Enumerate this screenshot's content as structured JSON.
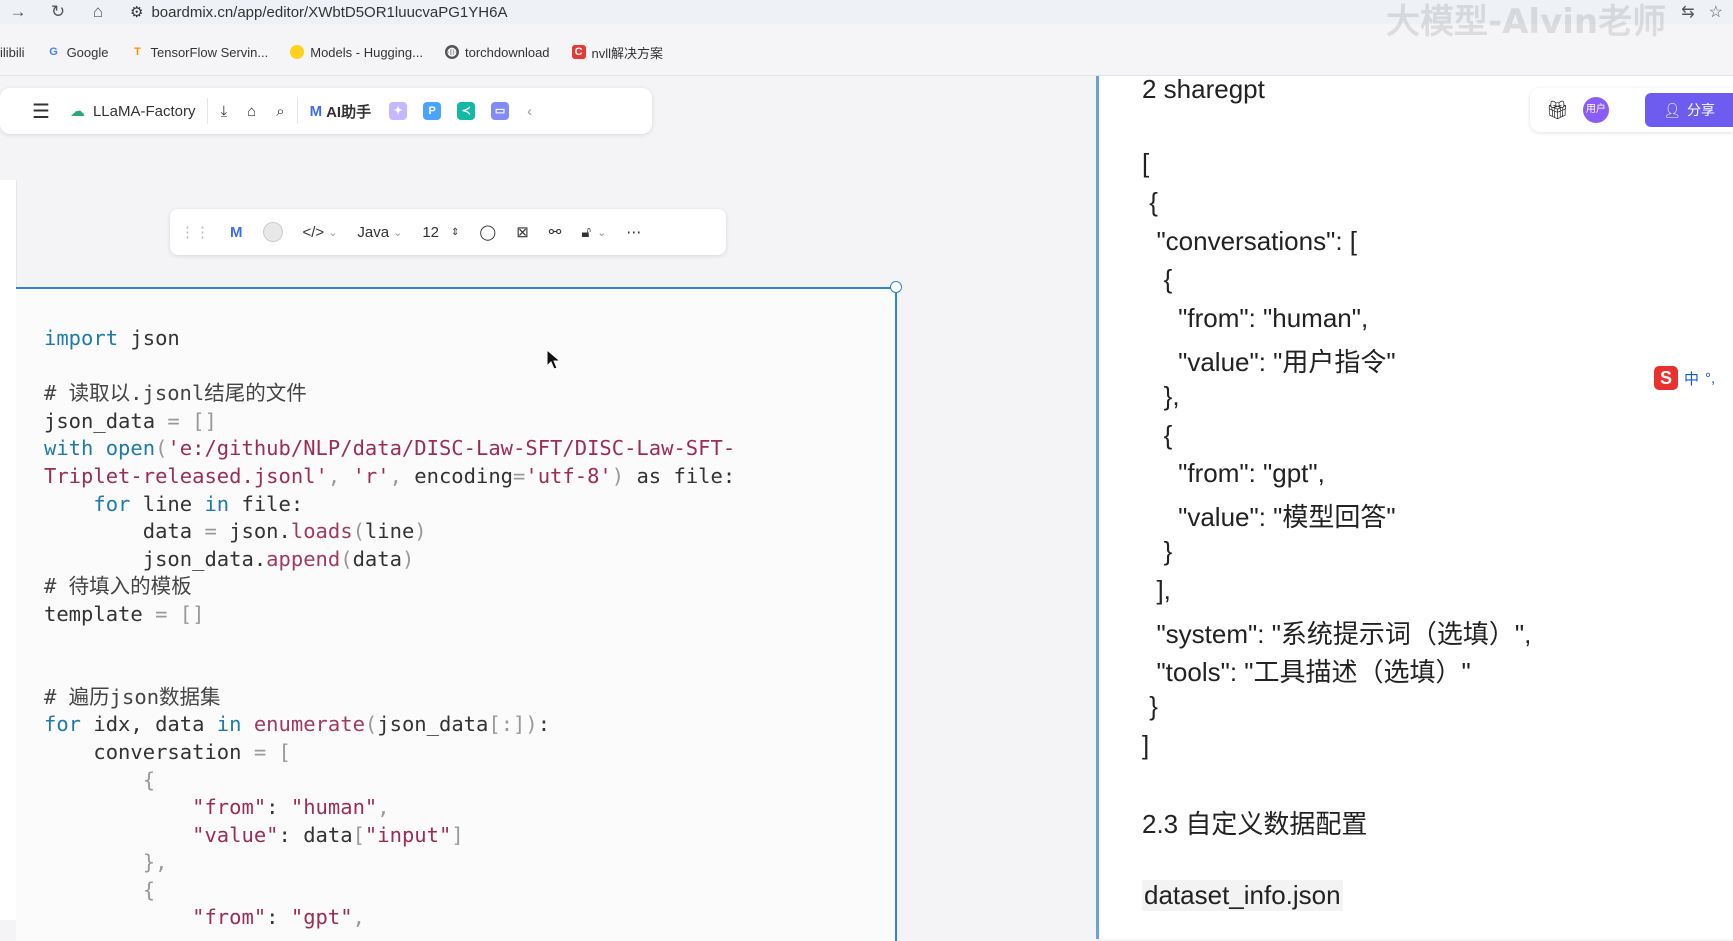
{
  "browser": {
    "url": "boardmix.cn/app/editor/XWbtD5OR1luucvaPG1YH6A",
    "watermark": "大模型-Alvin老师",
    "bookmarks": [
      {
        "label": "ilibili",
        "icon": "bilibili-icon"
      },
      {
        "label": "Google",
        "icon": "google-icon"
      },
      {
        "label": "TensorFlow Servin...",
        "icon": "tensorflow-icon"
      },
      {
        "label": "Models - Hugging...",
        "icon": "huggingface-icon"
      },
      {
        "label": "torchdownload",
        "icon": "globe-icon"
      },
      {
        "label": "nvll解决方案",
        "icon": "c-icon"
      }
    ]
  },
  "editor": {
    "file_name": "LLaMA-Factory",
    "ai_label": "AI助手",
    "code_language": "Java",
    "font_size": "12",
    "share_label": "分享",
    "avatar_label": "用户"
  },
  "code": {
    "lines": [
      "import json",
      "",
      "# 读取以.jsonl结尾的文件",
      "json_data = []",
      "with open('e:/github/NLP/data/DISC-Law-SFT/DISC-Law-SFT-",
      "Triplet-released.jsonl', 'r', encoding='utf-8') as file:",
      "    for line in file:",
      "        data = json.loads(line)",
      "        json_data.append(data)",
      "# 待填入的模板",
      "template = []",
      "",
      "",
      "# 遍历json数据集",
      "for idx, data in enumerate(json_data[:]):",
      "    conversation = [",
      "        {",
      "            \"from\": \"human\",",
      "            \"value\": data[\"input\"]",
      "        },",
      "        {",
      "            \"from\": \"gpt\","
    ]
  },
  "doc": {
    "heading_sharegpt": "2 sharegpt",
    "json_lines": [
      "[",
      " {",
      "  \"conversations\": [",
      "   {",
      "     \"from\": \"human\",",
      "     \"value\": \"用户指令\"",
      "   },",
      "   {",
      "     \"from\": \"gpt\",",
      "     \"value\": \"模型回答\"",
      "   }",
      "  ],",
      "  \"system\": \"系统提示词（选填）\",",
      "  \"tools\": \"工具描述（选填）\"",
      " }",
      "]"
    ],
    "heading_custom": "2.3 自定义数据配置",
    "filename": "dataset_info.json"
  },
  "ime": {
    "label": "中"
  }
}
